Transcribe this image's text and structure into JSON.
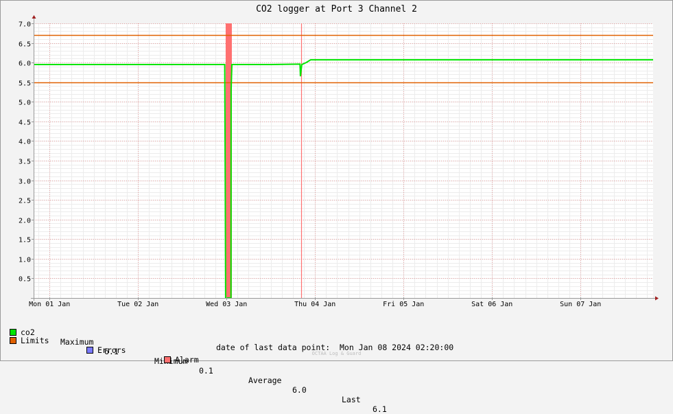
{
  "chart_data": {
    "type": "line",
    "title": "CO2 logger at Port 3 Channel 2",
    "xlabel": "",
    "ylabel": "",
    "ylim": [
      0,
      7.0
    ],
    "y_ticks": [
      "0.5",
      "1.0",
      "1.5",
      "2.0",
      "2.5",
      "3.0",
      "3.5",
      "4.0",
      "4.5",
      "5.0",
      "5.5",
      "6.0",
      "6.5",
      "7.0"
    ],
    "x_ticks": [
      "Mon 01 Jan",
      "Tue 02 Jan",
      "Wed 03 Jan",
      "Thu 04 Jan",
      "Fri 05 Jan",
      "Sat 06 Jan",
      "Sun 07 Jan"
    ],
    "x_range_days": [
      -0.18,
      6.82
    ],
    "grid": true,
    "limits": {
      "upper": 6.7,
      "lower": 5.5
    },
    "alarm_bands": [
      [
        1.99,
        2.06
      ]
    ],
    "alarm_lines": [
      2.84
    ],
    "series": [
      {
        "name": "co2",
        "color": "#00e600",
        "points": [
          [
            -0.18,
            5.95
          ],
          [
            0.5,
            5.95
          ],
          [
            1.0,
            5.95
          ],
          [
            1.5,
            5.95
          ],
          [
            1.98,
            5.95
          ],
          [
            1.985,
            3.0
          ],
          [
            1.99,
            0.0
          ],
          [
            2.05,
            0.0
          ],
          [
            2.052,
            5.3
          ],
          [
            2.06,
            5.95
          ],
          [
            2.5,
            5.95
          ],
          [
            2.83,
            5.96
          ],
          [
            2.835,
            5.65
          ],
          [
            2.85,
            5.95
          ],
          [
            2.9,
            6.0
          ],
          [
            2.95,
            6.07
          ],
          [
            3.5,
            6.07
          ],
          [
            4.0,
            6.07
          ],
          [
            4.5,
            6.07
          ],
          [
            5.0,
            6.07
          ],
          [
            5.5,
            6.07
          ],
          [
            6.0,
            6.07
          ],
          [
            6.5,
            6.07
          ],
          [
            6.82,
            6.07
          ]
        ]
      }
    ],
    "colors": {
      "co2": "#00e600",
      "limits": "#e06000",
      "errors": "#7a7aff",
      "alarm": "#ff7070"
    }
  },
  "legend": {
    "co2": {
      "name": "co2",
      "maximum_label": "Maximum",
      "maximum": "6.1",
      "minimum_label": "Minimum",
      "minimum": "0.1",
      "average_label": "Average",
      "average": "6.0",
      "last_label": "Last",
      "last": "6.1"
    },
    "limits": "Limits",
    "errors": "Errors",
    "alarm": "Alarm"
  },
  "footer": {
    "last_data_point": "date of last data point:  Mon Jan 08 2024 02:20:00",
    "watermark": "OCTAA Log & Guard"
  }
}
